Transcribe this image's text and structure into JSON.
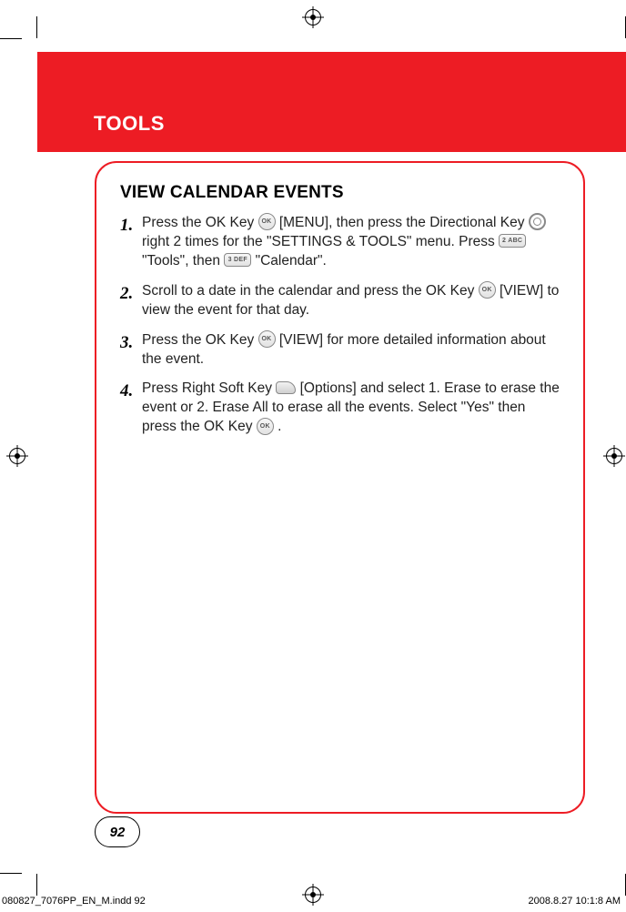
{
  "header": {
    "title": "TOOLS"
  },
  "section": {
    "title": "VIEW CALENDAR EVENTS"
  },
  "steps": [
    {
      "num": "1.",
      "parts": {
        "a": "Press the OK Key ",
        "b": " [MENU], then press the Directional Key ",
        "c": " right 2 times for the \"SETTINGS & TOOLS\" menu. Press ",
        "d": " \"Tools\", then ",
        "e": " \"Calendar\"."
      },
      "key2_label": "2 ABC",
      "key3_label": "3 DEF"
    },
    {
      "num": "2.",
      "parts": {
        "a": "Scroll to a date in the calendar and press the OK Key ",
        "b": " [VIEW] to view the event for that day."
      }
    },
    {
      "num": "3.",
      "parts": {
        "a": "Press the OK Key ",
        "b": " [VIEW] for more detailed information about the event."
      }
    },
    {
      "num": "4.",
      "parts": {
        "a": "Press Right Soft Key ",
        "b": " [Options] and select 1. Erase to erase the event or 2. Erase All to erase all the events. Select \"Yes\" then press the OK Key ",
        "c": " ."
      }
    }
  ],
  "ok_label": "OK",
  "page_number": "92",
  "footer": {
    "left": "080827_7076PP_EN_M.indd   92",
    "right": "2008.8.27   10:1:8 AM"
  }
}
